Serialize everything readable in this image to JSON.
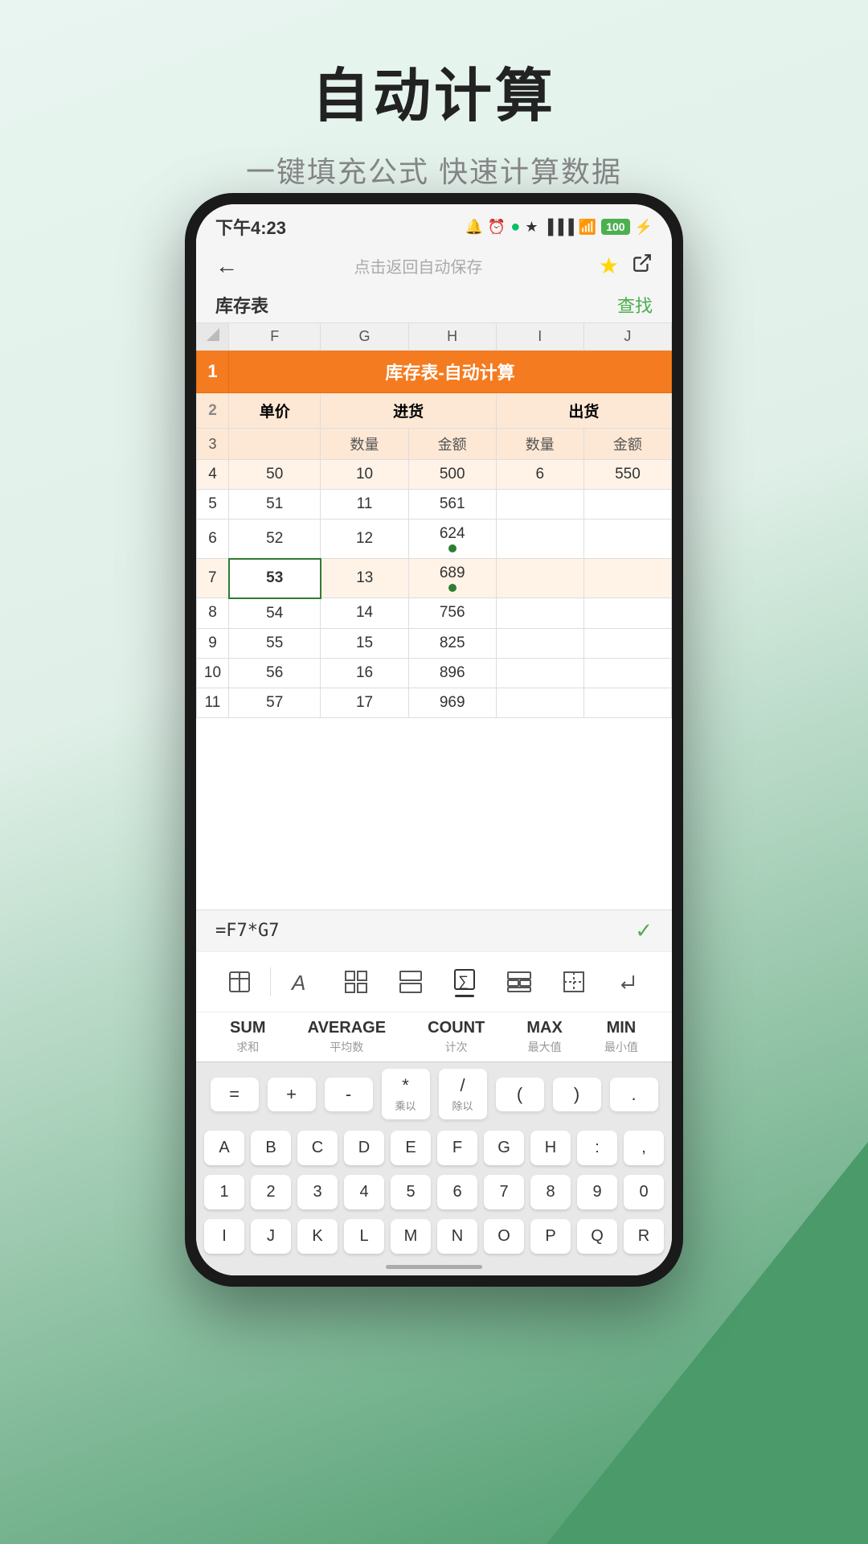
{
  "page": {
    "title": "自动计算",
    "subtitle": "一键填充公式 快速计算数据"
  },
  "status_bar": {
    "time": "下午4:23",
    "battery": "100",
    "icons": "🔔 ⏰ 🔵"
  },
  "nav": {
    "back": "←",
    "title": "点击返回自动保存",
    "star": "★",
    "share": "⬡"
  },
  "sheet": {
    "name": "库存表",
    "find": "查找",
    "spreadsheet_title": "库存表-自动计算",
    "columns": [
      "F",
      "G",
      "H",
      "I",
      "J"
    ],
    "rows": [
      {
        "num": 1,
        "type": "merged",
        "value": "库存表-自动计算"
      },
      {
        "num": 2,
        "type": "subheader",
        "cells": [
          "单价",
          "进货",
          "",
          "出货",
          ""
        ]
      },
      {
        "num": 3,
        "type": "subheader2",
        "cells": [
          "",
          "数量",
          "金额",
          "数量",
          "金额"
        ]
      },
      {
        "num": 4,
        "type": "data",
        "cells": [
          "50",
          "10",
          "500",
          "6",
          "550"
        ],
        "highlighted": true
      },
      {
        "num": 5,
        "type": "data",
        "cells": [
          "51",
          "11",
          "561",
          "",
          ""
        ],
        "highlighted": false
      },
      {
        "num": 6,
        "type": "data",
        "cells": [
          "52",
          "12",
          "624",
          "",
          ""
        ],
        "highlighted": false
      },
      {
        "num": 7,
        "type": "data",
        "cells": [
          "53",
          "13",
          "689",
          "",
          ""
        ],
        "selected": 0,
        "highlighted": true
      },
      {
        "num": 8,
        "type": "data",
        "cells": [
          "54",
          "14",
          "756",
          "",
          ""
        ],
        "highlighted": false
      },
      {
        "num": 9,
        "type": "data",
        "cells": [
          "55",
          "15",
          "825",
          "",
          ""
        ],
        "highlighted": false
      },
      {
        "num": 10,
        "type": "data",
        "cells": [
          "56",
          "16",
          "896",
          "",
          ""
        ],
        "highlighted": false
      },
      {
        "num": 11,
        "type": "data",
        "cells": [
          "57",
          "17",
          "969",
          "",
          ""
        ],
        "highlighted": false
      }
    ]
  },
  "formula_bar": {
    "formula": "=F7*G7",
    "confirm": "✓"
  },
  "toolbar": {
    "items": [
      "table",
      "text",
      "grid",
      "layout",
      "formula",
      "merge",
      "border",
      "enter"
    ]
  },
  "functions": [
    {
      "name": "SUM",
      "desc": "求和"
    },
    {
      "name": "AVERAGE",
      "desc": "平均数"
    },
    {
      "name": "COUNT",
      "desc": "计次"
    },
    {
      "name": "MAX",
      "desc": "最大值"
    },
    {
      "name": "MIN",
      "desc": "最小值"
    }
  ],
  "operators": [
    {
      "sym": "=",
      "sub": ""
    },
    {
      "sym": "+",
      "sub": ""
    },
    {
      "sym": "-",
      "sub": ""
    },
    {
      "sym": "·",
      "sub": "乘以"
    },
    {
      "sym": "/",
      "sub": "除以"
    },
    {
      "sym": "(",
      "sub": ""
    },
    {
      "sym": ")",
      "sub": ""
    },
    {
      "sym": ".",
      "sub": ""
    }
  ],
  "keyboard": {
    "rows": [
      [
        "A",
        "B",
        "C",
        "D",
        "E",
        "F",
        "G",
        "H",
        ":",
        ","
      ],
      [
        "1",
        "2",
        "3",
        "4",
        "5",
        "6",
        "7",
        "8",
        "9",
        "0"
      ],
      [
        "I",
        "J",
        "K",
        "L",
        "M",
        "N",
        "O",
        "P",
        "Q",
        "R"
      ]
    ]
  }
}
